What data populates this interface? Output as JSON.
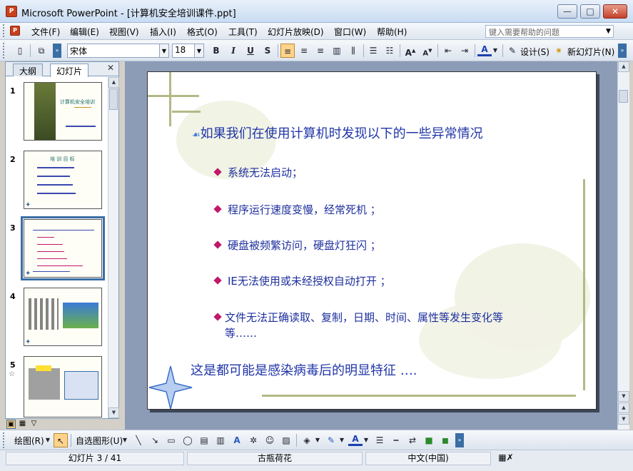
{
  "window": {
    "title": "Microsoft PowerPoint - [计算机安全培训课件.ppt]",
    "min_label": "—",
    "max_label": "□",
    "close_label": "✕"
  },
  "menu": {
    "items": [
      "文件(F)",
      "编辑(E)",
      "视图(V)",
      "插入(I)",
      "格式(O)",
      "工具(T)",
      "幻灯片放映(D)",
      "窗口(W)",
      "帮助(H)"
    ],
    "help_placeholder": "键入需要帮助的问题"
  },
  "toolbar": {
    "font_name": "宋体",
    "font_size": "18",
    "bold": "B",
    "italic": "I",
    "underline": "U",
    "shadow": "S",
    "design_label": "设计(S)",
    "new_slide_label": "新幻灯片(N)"
  },
  "left_pane": {
    "tab_outline": "大纲",
    "tab_slides": "幻灯片",
    "close": "✕",
    "thumbs": [
      {
        "num": "1",
        "title": "计算机安全培训"
      },
      {
        "num": "2",
        "title": "培 训 目 标"
      },
      {
        "num": "3",
        "title": ""
      },
      {
        "num": "4",
        "title": ""
      },
      {
        "num": "5",
        "sub": "☆",
        "title": ""
      }
    ]
  },
  "slide": {
    "heading": "如果我们在使用计算机时发现以下的一些异常情况",
    "bullets": [
      "系统无法启动；",
      "程序运行速度变慢，经常死机 ；",
      "硬盘被频繁访问，硬盘灯狂闪 ；",
      "IE无法使用或未经授权自动打开 ；",
      "文件无法正确读取、复制，日期、时间、属性等发生变化等",
      "等……"
    ],
    "conclusion": "这是都可能是感染病毒后的明显特征 …."
  },
  "drawbar": {
    "draw_label": "绘图(R)",
    "autoshape_label": "自选图形(U)"
  },
  "status": {
    "slide_pos": "幻灯片 3 / 41",
    "design": "古瓶荷花",
    "language": "中文(中国)"
  },
  "colors": {
    "slide_text": "#2035a8",
    "bullet": "#c0186a",
    "selected_thumb": "#3a6ea5"
  }
}
